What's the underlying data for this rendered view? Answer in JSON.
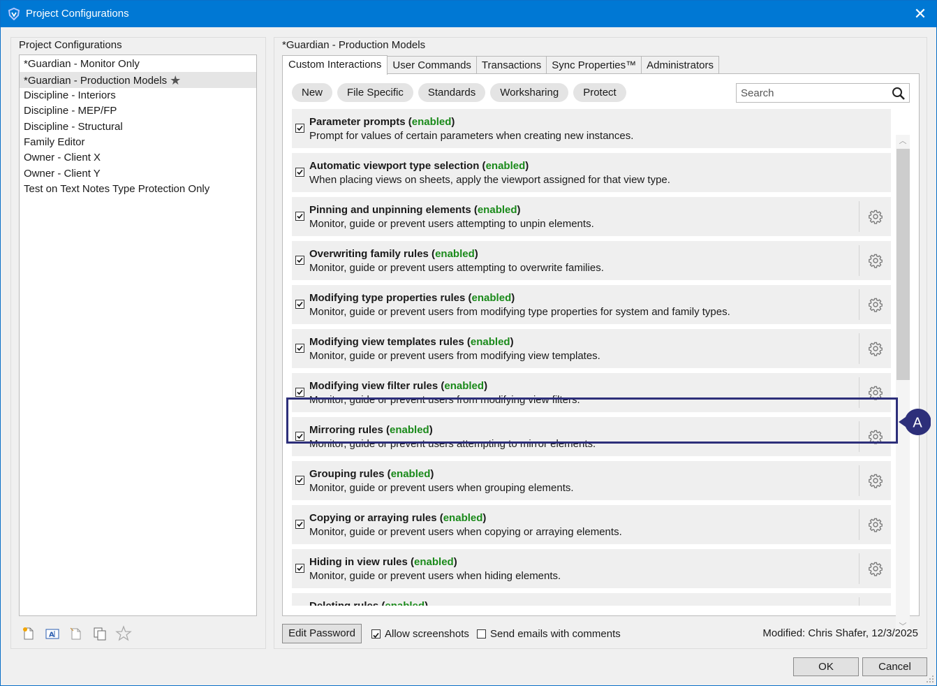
{
  "window": {
    "title": "Project Configurations",
    "close_glyph": "✕"
  },
  "left": {
    "label": "Project Configurations",
    "items": [
      {
        "label": "*Guardian - Monitor Only"
      },
      {
        "label": "*Guardian - Production Models",
        "starred": true,
        "star_glyph": "★"
      },
      {
        "label": "Discipline - Interiors"
      },
      {
        "label": "Discipline - MEP/FP"
      },
      {
        "label": "Discipline - Structural"
      },
      {
        "label": "Family Editor"
      },
      {
        "label": "Owner - Client X"
      },
      {
        "label": "Owner - Client Y"
      },
      {
        "label": "Test on Text Notes Type Protection Only"
      }
    ],
    "selected_index": 1,
    "tools": [
      "new-config-icon",
      "rename-config-icon",
      "copy-config-icon",
      "duplicate-config-icon",
      "star-icon"
    ]
  },
  "right": {
    "label": "*Guardian - Production Models",
    "tabs": [
      {
        "label": "Custom Interactions",
        "active": true
      },
      {
        "label": "User Commands"
      },
      {
        "label": "Transactions"
      },
      {
        "label": "Sync Properties™"
      },
      {
        "label": "Administrators"
      }
    ],
    "filters": [
      "New",
      "File Specific",
      "Standards",
      "Worksharing",
      "Protect"
    ],
    "search": {
      "placeholder": "Search",
      "value": ""
    },
    "enabled_color": "#1a8a1a",
    "rules": [
      {
        "title": "Parameter prompts",
        "status": "enabled",
        "desc": "Prompt for values of certain parameters when creating new instances.",
        "checked": true,
        "has_settings": false
      },
      {
        "title": "Automatic viewport type selection",
        "status": "enabled",
        "desc": "When placing views on sheets, apply the viewport assigned for that view type.",
        "checked": true,
        "has_settings": false
      },
      {
        "title": "Pinning and unpinning elements",
        "status": "enabled",
        "desc": "Monitor, guide or prevent users attempting to unpin elements.",
        "checked": true,
        "has_settings": true
      },
      {
        "title": "Overwriting family rules",
        "status": "enabled",
        "desc": "Monitor, guide or prevent users attempting to overwrite families.",
        "checked": true,
        "has_settings": true
      },
      {
        "title": "Modifying type properties rules",
        "status": "enabled",
        "desc": "Monitor, guide or prevent users from modifying type properties for system and family types.",
        "checked": true,
        "has_settings": true
      },
      {
        "title": "Modifying view templates rules",
        "status": "enabled",
        "desc": "Monitor, guide or prevent users from modifying view templates.",
        "checked": true,
        "has_settings": true
      },
      {
        "title": "Modifying view filter rules",
        "status": "enabled",
        "desc": "Monitor, guide or prevent users from modifying view filters.",
        "checked": true,
        "has_settings": true,
        "highlighted": true
      },
      {
        "title": "Mirroring rules",
        "status": "enabled",
        "desc": "Monitor, guide or prevent users attempting to mirror elements.",
        "checked": true,
        "has_settings": true
      },
      {
        "title": "Grouping rules",
        "status": "enabled",
        "desc": "Monitor, guide or prevent users when grouping elements.",
        "checked": true,
        "has_settings": true
      },
      {
        "title": "Copying or arraying rules",
        "status": "enabled",
        "desc": "Monitor, guide or prevent users when copying or arraying elements.",
        "checked": true,
        "has_settings": true
      },
      {
        "title": "Hiding in view rules",
        "status": "enabled",
        "desc": "Monitor, guide or prevent users when hiding elements.",
        "checked": true,
        "has_settings": true
      },
      {
        "title": "Deleting rules",
        "status": "enabled",
        "desc": "",
        "checked": true,
        "has_settings": true
      }
    ],
    "callout_label": "A",
    "callout_color": "#2d2f7a"
  },
  "bottom": {
    "edit_password": "Edit Password",
    "allow_screenshots": {
      "label": "Allow screenshots",
      "checked": true
    },
    "send_emails": {
      "label": "Send emails with comments",
      "checked": false
    },
    "modified": "Modified: Chris Shafer, 12/3/2025",
    "ok": "OK",
    "cancel": "Cancel"
  },
  "colors": {
    "titlebar": "#0078d4",
    "highlight": "#2d2f7a"
  }
}
